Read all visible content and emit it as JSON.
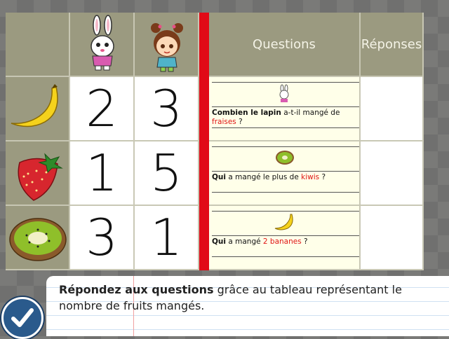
{
  "table": {
    "header": {
      "questions_label": "Questions",
      "answers_label": "Réponses",
      "characters": [
        "rabbit",
        "girl"
      ]
    },
    "rows": [
      {
        "fruit": "banana",
        "rabbit": "2",
        "girl": "3",
        "question": {
          "icon": "rabbit",
          "bold": "Combien le lapin",
          "pre": " a-t-il mangé de",
          "highlight": "fraises",
          "post": " ?"
        }
      },
      {
        "fruit": "strawberry",
        "rabbit": "1",
        "girl": "5",
        "question": {
          "icon": "kiwi",
          "bold": "Qui",
          "pre": " a mangé le plus de ",
          "highlight": "kiwis",
          "post": " ?"
        }
      },
      {
        "fruit": "kiwi",
        "rabbit": "3",
        "girl": "1",
        "question": {
          "icon": "banana",
          "bold": "Qui",
          "pre": " a mangé ",
          "highlight": "2 bananes",
          "post": " ?"
        }
      }
    ]
  },
  "instruction": {
    "bold": "Répondez aux questions",
    "rest": " grâce au tableau représentant le nombre de fruits mangés."
  },
  "colors": {
    "accent_red": "#e10a17",
    "olive": "#9b9a80",
    "check_blue": "#2a5a8c"
  },
  "icons": {
    "validate": "check-icon"
  }
}
